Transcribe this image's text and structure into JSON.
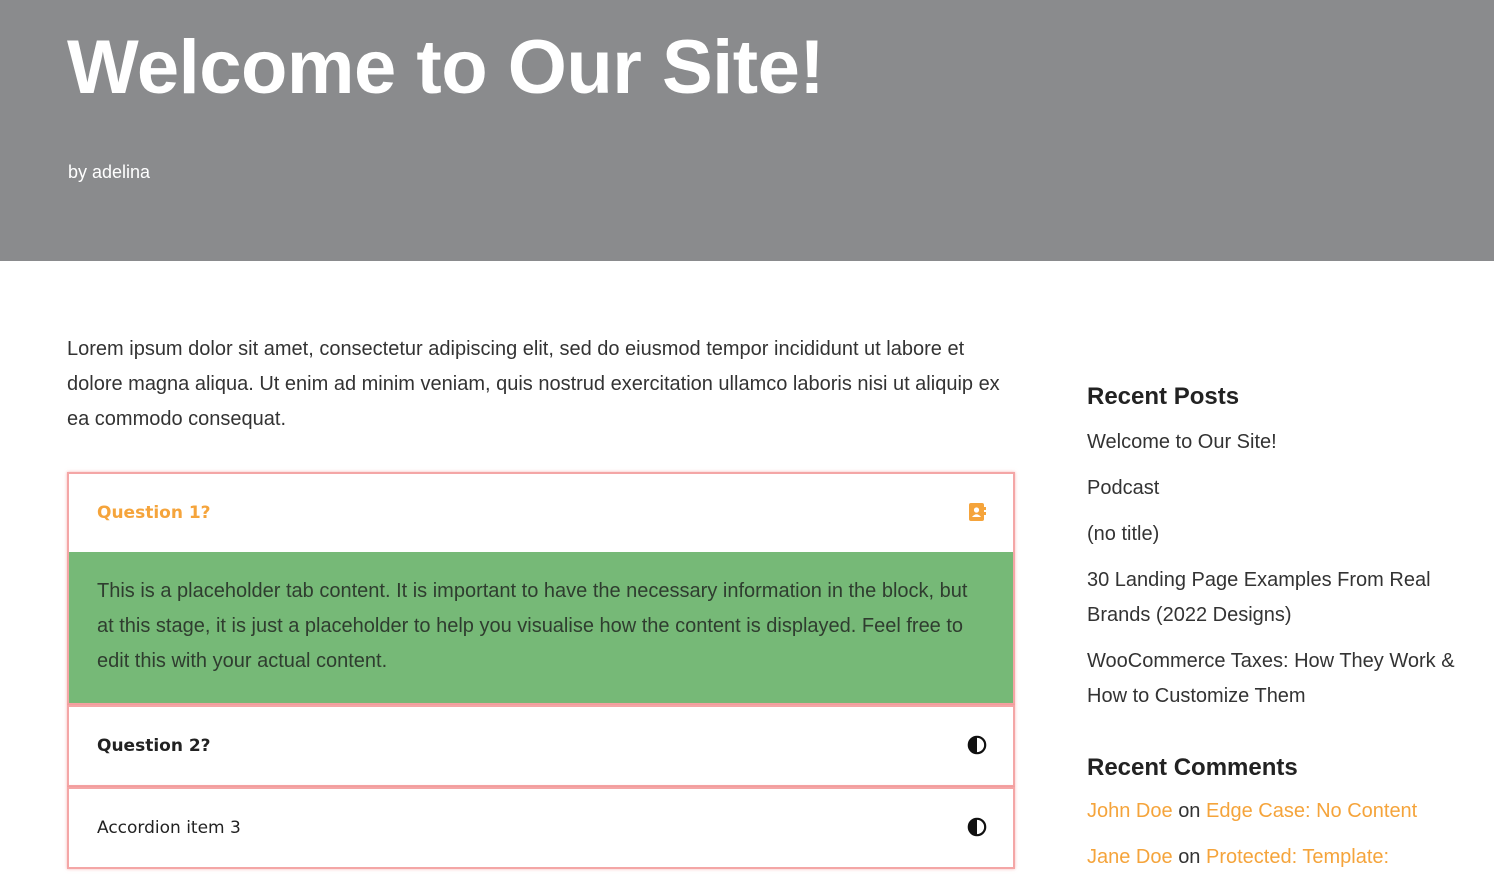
{
  "header": {
    "title": "Welcome to Our Site!",
    "byline": "by adelina"
  },
  "intro": "Lorem ipsum dolor sit amet, consectetur adipiscing elit, sed do eiusmod tempor incididunt ut labore et dolore magna aliqua. Ut enim ad minim veniam, quis nostrud exercitation ullamco laboris nisi ut aliquip ex ea commodo consequat.",
  "accordion": {
    "items": [
      {
        "title": "Question 1?",
        "icon": "contact-book-icon",
        "expanded": true,
        "content": "This is a placeholder tab content. It is important to have the necessary information in the block, but at this stage, it is just a placeholder to help you visualise how the content is displayed. Feel free to edit this with your actual content."
      },
      {
        "title": "Question 2?",
        "icon": "contrast-icon",
        "expanded": false
      },
      {
        "title": "Accordion item 3",
        "icon": "contrast-icon",
        "expanded": false
      }
    ]
  },
  "sidebar": {
    "recent_posts": {
      "title": "Recent Posts",
      "items": [
        "Welcome to Our Site!",
        "Podcast",
        "(no title)",
        "30 Landing Page Examples From Real Brands (2022 Designs)",
        "WooCommerce Taxes: How They Work & How to Customize Them"
      ]
    },
    "recent_comments": {
      "title": "Recent Comments",
      "items": [
        {
          "author": "John Doe",
          "connector": "on",
          "post": "Edge Case: No Content"
        },
        {
          "author": "Jane Doe",
          "connector": "on",
          "post": "Protected: Template:"
        }
      ]
    }
  },
  "colors": {
    "hero_bg": "#8a8b8d",
    "accent": "#f5a43b",
    "panel_bg": "#76b977",
    "accordion_border": "#f4a6a6"
  }
}
